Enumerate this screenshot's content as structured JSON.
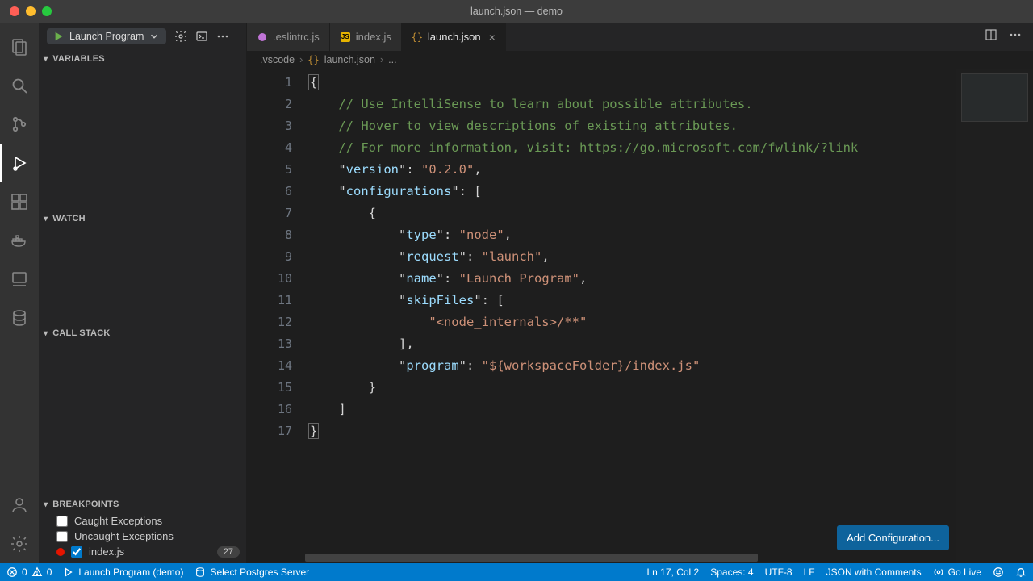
{
  "window_title": "launch.json — demo",
  "run_config_name": "Launch Program",
  "tabs": [
    {
      "label": ".eslintrc.js",
      "icon": "eslint"
    },
    {
      "label": "index.js",
      "icon": "js"
    },
    {
      "label": "launch.json",
      "icon": "json",
      "active": true,
      "dirty": false
    }
  ],
  "breadcrumbs": {
    "folder": ".vscode",
    "file": "launch.json",
    "trail": "..."
  },
  "sidebar": {
    "sections": {
      "variables": "VARIABLES",
      "watch": "WATCH",
      "callstack": "CALL STACK",
      "breakpoints": "BREAKPOINTS"
    },
    "breakpoints": {
      "caught_label": "Caught Exceptions",
      "uncaught_label": "Uncaught Exceptions",
      "entries": [
        {
          "file": "index.js",
          "line": 27,
          "checked": true
        }
      ]
    }
  },
  "editor": {
    "line_count": 17,
    "code_lines": [
      "{",
      "    // Use IntelliSense to learn about possible attributes.",
      "    // Hover to view descriptions of existing attributes.",
      "    // For more information, visit: https://go.microsoft.com/fwlink/?link",
      "    \"version\": \"0.2.0\",",
      "    \"configurations\": [",
      "        {",
      "            \"type\": \"node\",",
      "            \"request\": \"launch\",",
      "            \"name\": \"Launch Program\",",
      "            \"skipFiles\": [",
      "                \"<node_internals>/**\"",
      "            ],",
      "            \"program\": \"${workspaceFolder}/index.js\"",
      "        }",
      "    ]",
      "}"
    ],
    "add_config_button": "Add Configuration..."
  },
  "statusbar": {
    "errors": 0,
    "warnings": 0,
    "launch_status": "Launch Program (demo)",
    "postgres": "Select Postgres Server",
    "cursor": "Ln 17, Col 2",
    "spaces": "Spaces: 4",
    "encoding": "UTF-8",
    "eol": "LF",
    "language": "JSON with Comments",
    "golive": "Go Live"
  }
}
